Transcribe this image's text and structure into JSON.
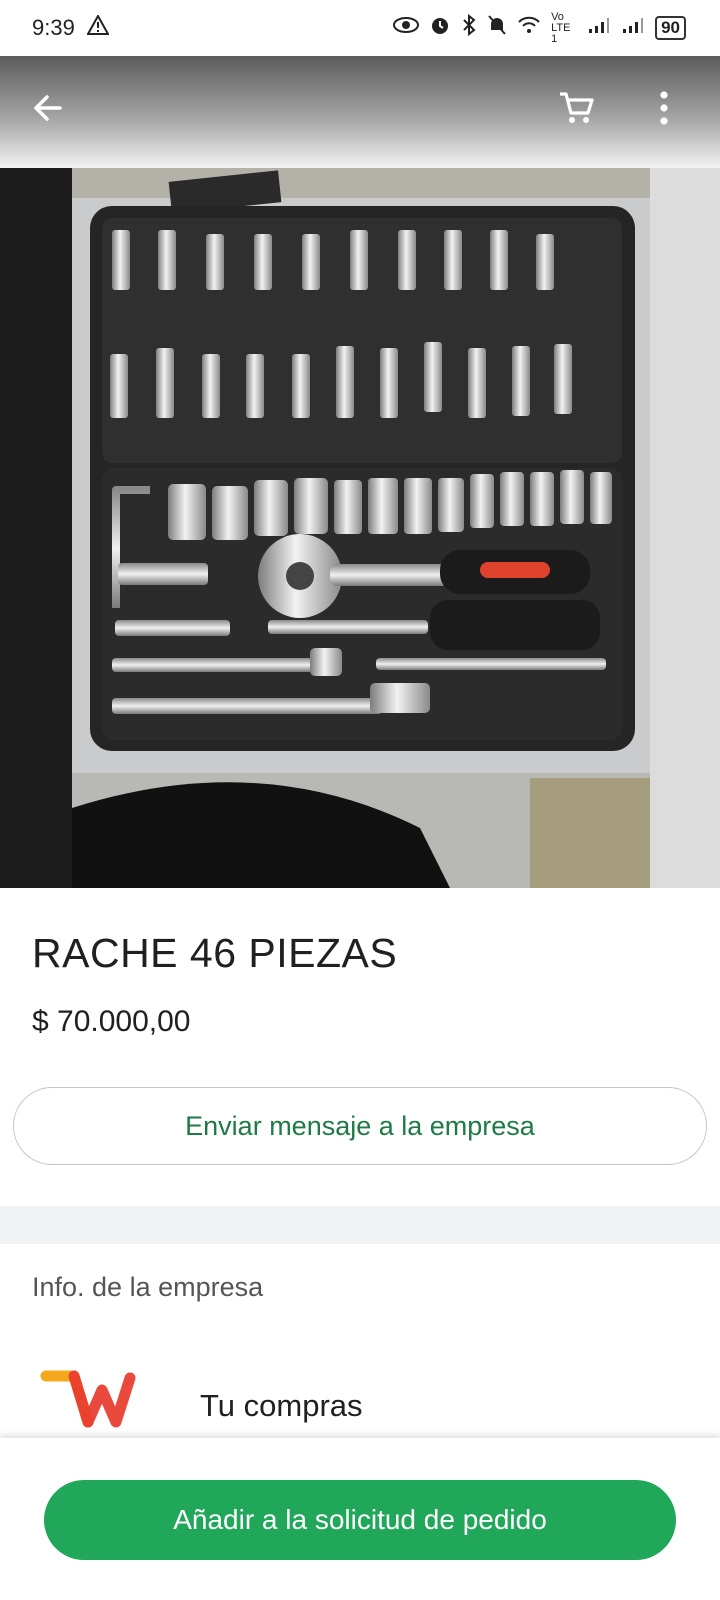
{
  "status_bar": {
    "time": "9:39",
    "network": "Vo LTE 1",
    "battery": "90"
  },
  "toolbar": {
    "back_icon": "arrow-left-icon",
    "cart_icon": "cart-icon",
    "menu_icon": "more-vert-icon"
  },
  "product": {
    "title": "RACHE 46 PIEZAS",
    "price": "$ 70.000,00"
  },
  "actions": {
    "message_button": "Enviar mensaje a la empresa",
    "add_to_order_button": "Añadir a la solicitud de pedido"
  },
  "company": {
    "section_title": "Info. de la empresa",
    "name": "Tu compras"
  },
  "colors": {
    "accent_green": "#21a75a",
    "message_text_green": "#1e7a46"
  }
}
